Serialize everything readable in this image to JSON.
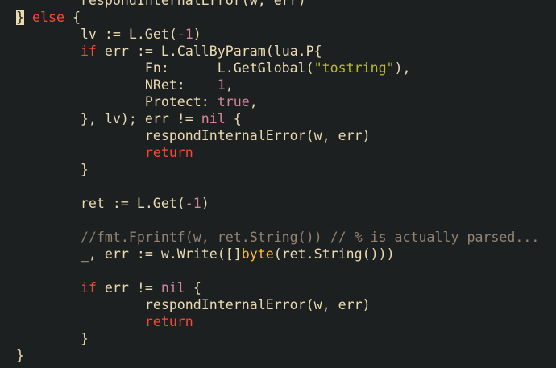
{
  "theme": {
    "background": "#1d2021",
    "plain": "#ebdbb2",
    "keyword": "#fb4934",
    "number": "#d3869b",
    "string": "#b8bb26",
    "type": "#fabd2f",
    "comment": "#928374",
    "cursor": "#ebdbb2"
  },
  "editor": {
    "lines": [
      [
        {
          "t": "        respondInternalError(w, err)",
          "c": "plain"
        }
      ],
      [
        {
          "t": "}",
          "c": "cursor"
        },
        {
          "t": " ",
          "c": "plain"
        },
        {
          "t": "else",
          "c": "keyword"
        },
        {
          "t": " {",
          "c": "plain"
        }
      ],
      [
        {
          "t": "        lv := L.Get(",
          "c": "plain"
        },
        {
          "t": "-1",
          "c": "number"
        },
        {
          "t": ")",
          "c": "plain"
        }
      ],
      [
        {
          "t": "        ",
          "c": "plain"
        },
        {
          "t": "if",
          "c": "keyword"
        },
        {
          "t": " err := L.CallByParam(lua.P{",
          "c": "plain"
        }
      ],
      [
        {
          "t": "                Fn:      L.GetGlobal(",
          "c": "plain"
        },
        {
          "t": "\"tostring\"",
          "c": "string"
        },
        {
          "t": "),",
          "c": "plain"
        }
      ],
      [
        {
          "t": "                NRet:    ",
          "c": "plain"
        },
        {
          "t": "1",
          "c": "number"
        },
        {
          "t": ",",
          "c": "plain"
        }
      ],
      [
        {
          "t": "                Protect: ",
          "c": "plain"
        },
        {
          "t": "true",
          "c": "number"
        },
        {
          "t": ",",
          "c": "plain"
        }
      ],
      [
        {
          "t": "        }, lv); err != ",
          "c": "plain"
        },
        {
          "t": "nil",
          "c": "number"
        },
        {
          "t": " {",
          "c": "plain"
        }
      ],
      [
        {
          "t": "                respondInternalError(w, err)",
          "c": "plain"
        }
      ],
      [
        {
          "t": "                ",
          "c": "plain"
        },
        {
          "t": "return",
          "c": "keyword"
        }
      ],
      [
        {
          "t": "        }",
          "c": "plain"
        }
      ],
      [],
      [
        {
          "t": "        ret := L.Get(",
          "c": "plain"
        },
        {
          "t": "-1",
          "c": "number"
        },
        {
          "t": ")",
          "c": "plain"
        }
      ],
      [],
      [
        {
          "t": "        //fmt.Fprintf(w, ret.String()) // % is actually parsed...",
          "c": "comment"
        }
      ],
      [
        {
          "t": "        _, err := w.Write([]",
          "c": "plain"
        },
        {
          "t": "byte",
          "c": "type"
        },
        {
          "t": "(ret.String()))",
          "c": "plain"
        }
      ],
      [],
      [
        {
          "t": "        ",
          "c": "plain"
        },
        {
          "t": "if",
          "c": "keyword"
        },
        {
          "t": " err != ",
          "c": "plain"
        },
        {
          "t": "nil",
          "c": "number"
        },
        {
          "t": " {",
          "c": "plain"
        }
      ],
      [
        {
          "t": "                respondInternalError(w, err)",
          "c": "plain"
        }
      ],
      [
        {
          "t": "                ",
          "c": "plain"
        },
        {
          "t": "return",
          "c": "keyword"
        }
      ],
      [
        {
          "t": "        }",
          "c": "plain"
        }
      ],
      [
        {
          "t": "}",
          "c": "plain"
        }
      ]
    ]
  }
}
